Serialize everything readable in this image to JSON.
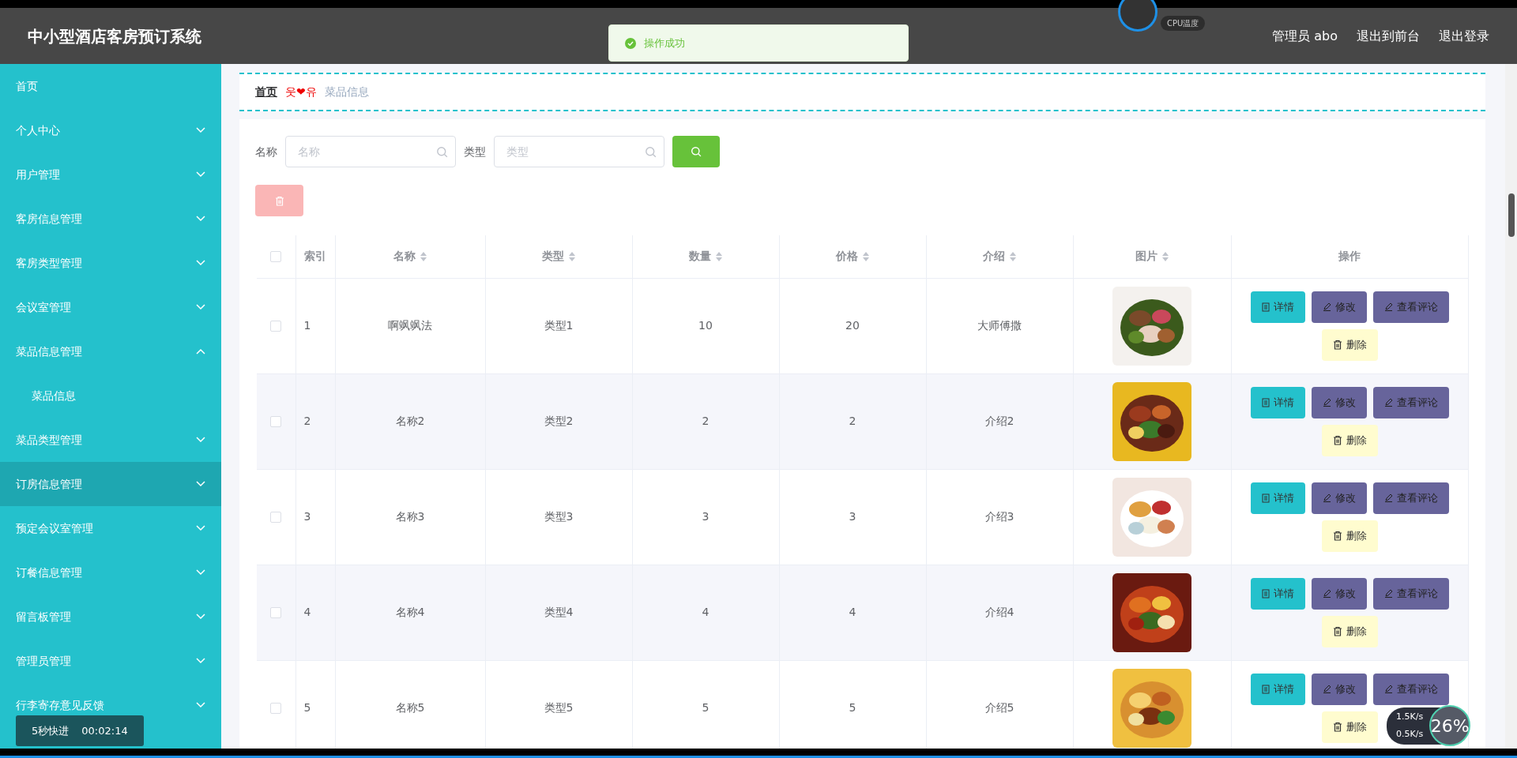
{
  "header": {
    "title": "中小型酒店客房预订系统",
    "user": "管理员 abo",
    "links": [
      "退出到前台",
      "退出登录"
    ]
  },
  "toast": {
    "text": "操作成功"
  },
  "sidebar": {
    "items": [
      {
        "label": "首页",
        "kind": "link",
        "selected": false
      },
      {
        "label": "个人中心",
        "kind": "menu",
        "expanded": false,
        "selected": false
      },
      {
        "label": "用户管理",
        "kind": "menu",
        "expanded": false,
        "selected": false
      },
      {
        "label": "客房信息管理",
        "kind": "menu",
        "expanded": false,
        "selected": false
      },
      {
        "label": "客房类型管理",
        "kind": "menu",
        "expanded": false,
        "selected": false
      },
      {
        "label": "会议室管理",
        "kind": "menu",
        "expanded": false,
        "selected": false
      },
      {
        "label": "菜品信息管理",
        "kind": "menu",
        "expanded": true,
        "selected": false,
        "children": [
          {
            "label": "菜品信息",
            "selected": false
          }
        ]
      },
      {
        "label": "菜品类型管理",
        "kind": "menu",
        "expanded": false,
        "selected": false
      },
      {
        "label": "订房信息管理",
        "kind": "menu",
        "expanded": false,
        "selected": true
      },
      {
        "label": "预定会议室管理",
        "kind": "menu",
        "expanded": false,
        "selected": false
      },
      {
        "label": "订餐信息管理",
        "kind": "menu",
        "expanded": false,
        "selected": false
      },
      {
        "label": "留言板管理",
        "kind": "menu",
        "expanded": false,
        "selected": false
      },
      {
        "label": "管理员管理",
        "kind": "menu",
        "expanded": false,
        "selected": false
      },
      {
        "label": "行李寄存意见反馈",
        "kind": "menu",
        "expanded": false,
        "selected": false
      }
    ]
  },
  "breadcrumb": {
    "items": [
      "首页",
      "菜品信息"
    ],
    "separator": "웃❤유"
  },
  "search": {
    "fields": [
      {
        "label": "名称",
        "placeholder": "名称"
      },
      {
        "label": "类型",
        "placeholder": "类型"
      }
    ]
  },
  "delete_button": {
    "disabled": true
  },
  "table": {
    "select_all": {
      "checked": false
    },
    "columns": [
      {
        "label": "索引",
        "sortable": false
      },
      {
        "label": "名称",
        "sortable": true
      },
      {
        "label": "类型",
        "sortable": true
      },
      {
        "label": "数量",
        "sortable": true
      },
      {
        "label": "价格",
        "sortable": true
      },
      {
        "label": "介绍",
        "sortable": true
      },
      {
        "label": "图片",
        "sortable": true
      },
      {
        "label": "操作",
        "sortable": false
      }
    ],
    "rows": [
      {
        "checked": false,
        "cells": [
          "1",
          "啊飒飒法",
          "类型1",
          "10",
          "20",
          "大师傅撒"
        ],
        "image": {
          "kind": "picture"
        },
        "actions": [
          {
            "kind": "detail",
            "label": "详情"
          },
          {
            "kind": "edit",
            "label": "修改"
          },
          {
            "kind": "comments",
            "label": "查看评论"
          },
          {
            "kind": "delete",
            "label": "删除"
          }
        ]
      },
      {
        "checked": false,
        "cells": [
          "2",
          "名称2",
          "类型2",
          "2",
          "2",
          "介绍2"
        ],
        "image": {
          "kind": "picture"
        },
        "actions": [
          {
            "kind": "detail",
            "label": "详情"
          },
          {
            "kind": "edit",
            "label": "修改"
          },
          {
            "kind": "comments",
            "label": "查看评论"
          },
          {
            "kind": "delete",
            "label": "删除"
          }
        ]
      },
      {
        "checked": false,
        "cells": [
          "3",
          "名称3",
          "类型3",
          "3",
          "3",
          "介绍3"
        ],
        "image": {
          "kind": "picture"
        },
        "actions": [
          {
            "kind": "detail",
            "label": "详情"
          },
          {
            "kind": "edit",
            "label": "修改"
          },
          {
            "kind": "comments",
            "label": "查看评论"
          },
          {
            "kind": "delete",
            "label": "删除"
          }
        ]
      },
      {
        "checked": false,
        "cells": [
          "4",
          "名称4",
          "类型4",
          "4",
          "4",
          "介绍4"
        ],
        "image": {
          "kind": "picture"
        },
        "actions": [
          {
            "kind": "detail",
            "label": "详情"
          },
          {
            "kind": "edit",
            "label": "修改"
          },
          {
            "kind": "comments",
            "label": "查看评论"
          },
          {
            "kind": "delete",
            "label": "删除"
          }
        ]
      },
      {
        "checked": false,
        "cells": [
          "5",
          "名称5",
          "类型5",
          "5",
          "5",
          "介绍5"
        ],
        "image": {
          "kind": "picture"
        },
        "actions": [
          {
            "kind": "detail",
            "label": "详情"
          },
          {
            "kind": "edit",
            "label": "修改"
          },
          {
            "kind": "comments",
            "label": "查看评论"
          },
          {
            "kind": "delete",
            "label": "删除"
          }
        ]
      }
    ]
  },
  "cpu_widget": {
    "label": "CPU温度"
  },
  "video_overlay": {
    "label": "5秒快进",
    "time": "00:02:14"
  },
  "network_widget": {
    "upload": "1.5K/s",
    "download": "0.5K/s",
    "usage": "26%"
  }
}
